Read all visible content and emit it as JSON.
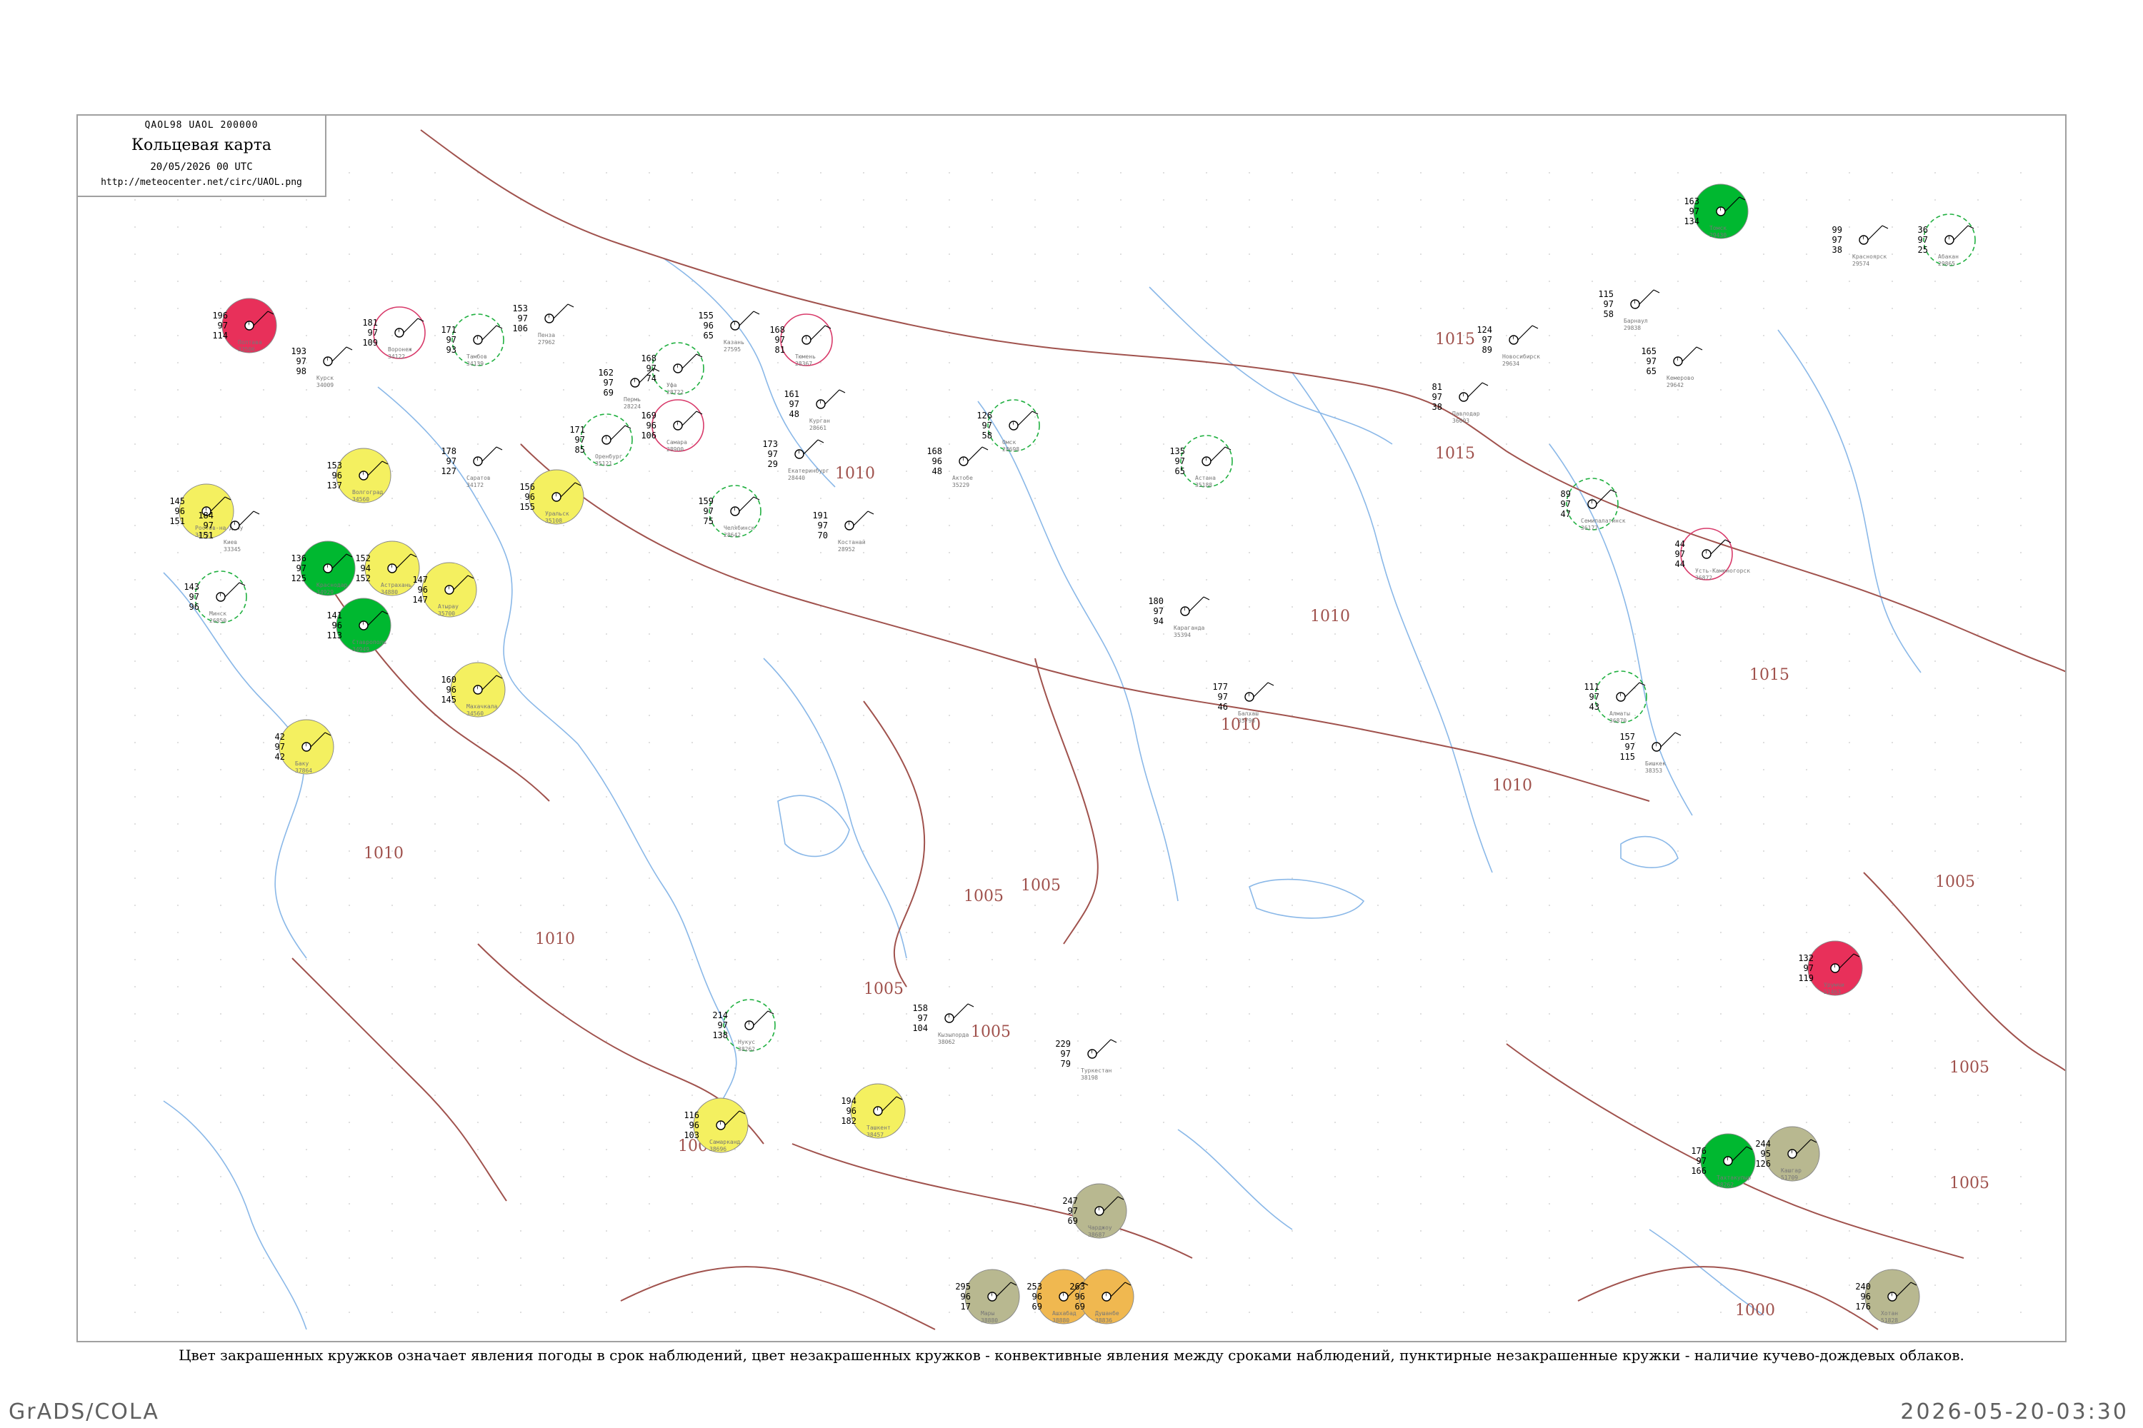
{
  "header": {
    "code": "QAOL98  UAOL  200000",
    "title": "Кольцевая карта",
    "datetime": "20/05/2026 00 UTC",
    "url": "http://meteocenter.net/circ/UAOL.png"
  },
  "caption": "Цвет закрашенных кружков означает явления погоды в срок наблюдений, цвет незакрашенных кружков - конвективные явления между сроками наблюдений, пунктирные незакрашенные кружки - наличие кучево-дождевых облаков.",
  "footer": {
    "left": "GrADS/COLA",
    "right": "2026-05-20-03:30"
  },
  "colors": {
    "isobar": "#a0524d",
    "river": "#8ab8e8",
    "green_fill": "#00b830",
    "yellow_fill": "#f4f060",
    "red_fill": "#e8305a",
    "olive_fill": "#b8b890",
    "orange_fill": "#f0b850",
    "green_ring": "#20b040",
    "pink_ring": "#d83a6a"
  },
  "isobar_labels": [
    "1015",
    "1015",
    "1015",
    "1010",
    "1010",
    "1010",
    "1010",
    "1010",
    "1010",
    "1005",
    "1005",
    "1005",
    "1005",
    "1005",
    "1005",
    "1005",
    "1005",
    "1000"
  ],
  "stations": [
    {
      "name": "Полтава",
      "id": "33506",
      "t": "196",
      "p": "97",
      "v": "114",
      "fill": "red"
    },
    {
      "name": "Курск",
      "id": "34009",
      "t": "193",
      "p": "97",
      "v": "98"
    },
    {
      "name": "Воронеж",
      "id": "34122",
      "t": "181",
      "p": "97",
      "v": "109"
    },
    {
      "name": "Тамбов",
      "id": "34139",
      "t": "171",
      "p": "97",
      "v": "93"
    },
    {
      "name": "Пенза",
      "id": "27962",
      "t": "153",
      "p": "97",
      "v": "106"
    },
    {
      "name": "Саратов",
      "id": "34172",
      "t": "178",
      "p": "97",
      "v": "127"
    },
    {
      "name": "Волгоград",
      "id": "34560",
      "t": "153",
      "p": "96",
      "v": "137",
      "fill": "yellow"
    },
    {
      "name": "Астрахань",
      "id": "34880",
      "t": "152",
      "p": "94",
      "v": "152",
      "fill": "yellow"
    },
    {
      "name": "Ростов-на-Дону",
      "id": "34731",
      "t": "145",
      "p": "96",
      "v": "151",
      "fill": "yellow"
    },
    {
      "name": "Краснодар",
      "id": "34929",
      "t": "136",
      "p": "97",
      "v": "125",
      "fill": "green"
    },
    {
      "name": "Ставрополь",
      "id": "34949",
      "t": "141",
      "p": "96",
      "v": "113",
      "fill": "green"
    },
    {
      "name": "Махачкала",
      "id": "34560",
      "t": "160",
      "p": "96",
      "v": "145",
      "fill": "yellow"
    },
    {
      "name": "Баку",
      "id": "37864",
      "t": "42",
      "p": "97",
      "v": "42",
      "fill": "yellow"
    },
    {
      "name": "Уральск",
      "id": "35108",
      "t": "156",
      "p": "96",
      "v": "155",
      "fill": "yellow"
    },
    {
      "name": "Атырау",
      "id": "35700",
      "t": "147",
      "p": "96",
      "v": "147",
      "fill": "yellow"
    },
    {
      "name": "Оренбург",
      "id": "35121",
      "t": "171",
      "p": "97",
      "v": "85"
    },
    {
      "name": "Самара",
      "id": "28900",
      "t": "169",
      "p": "96",
      "v": "106"
    },
    {
      "name": "Казань",
      "id": "27595",
      "t": "155",
      "p": "96",
      "v": "65"
    },
    {
      "name": "Уфа",
      "id": "28722",
      "t": "168",
      "p": "97",
      "v": "74"
    },
    {
      "name": "Пермь",
      "id": "28224",
      "t": "162",
      "p": "97",
      "v": "69"
    },
    {
      "name": "Екатеринбург",
      "id": "28440",
      "t": "173",
      "p": "97",
      "v": "29"
    },
    {
      "name": "Челябинск",
      "id": "28642",
      "t": "159",
      "p": "97",
      "v": "75"
    },
    {
      "name": "Курган",
      "id": "28661",
      "t": "161",
      "p": "97",
      "v": "48"
    },
    {
      "name": "Тюмень",
      "id": "28367",
      "t": "168",
      "p": "97",
      "v": "81"
    },
    {
      "name": "Омск",
      "id": "28698",
      "t": "126",
      "p": "97",
      "v": "58"
    },
    {
      "name": "Актобе",
      "id": "35229",
      "t": "168",
      "p": "96",
      "v": "48"
    },
    {
      "name": "Костанай",
      "id": "28952",
      "t": "191",
      "p": "97",
      "v": "70"
    },
    {
      "name": "Астана",
      "id": "35188",
      "t": "135",
      "p": "97",
      "v": "65"
    },
    {
      "name": "Караганда",
      "id": "35394",
      "t": "180",
      "p": "97",
      "v": "94"
    },
    {
      "name": "Павлодар",
      "id": "36003",
      "t": "81",
      "p": "97",
      "v": "38"
    },
    {
      "name": "Семипалатинск",
      "id": "36177",
      "t": "89",
      "p": "97",
      "v": "47"
    },
    {
      "name": "Новосибирск",
      "id": "29634",
      "t": "124",
      "p": "97",
      "v": "89"
    },
    {
      "name": "Барнаул",
      "id": "29838",
      "t": "115",
      "p": "97",
      "v": "58"
    },
    {
      "name": "Томск",
      "id": "29430",
      "t": "163",
      "p": "97",
      "v": "134",
      "fill": "green"
    },
    {
      "name": "Кемерово",
      "id": "29642",
      "t": "165",
      "p": "97",
      "v": "65"
    },
    {
      "name": "Красноярск",
      "id": "29574",
      "t": "99",
      "p": "97",
      "v": "38"
    },
    {
      "name": "Абакан",
      "id": "29865",
      "t": "36",
      "p": "97",
      "v": "25"
    },
    {
      "name": "Усть-Каменогорск",
      "id": "36872",
      "t": "44",
      "p": "97",
      "v": "44"
    },
    {
      "name": "Балхаш",
      "id": "35796",
      "t": "177",
      "p": "97",
      "v": "46"
    },
    {
      "name": "Алматы",
      "id": "36870",
      "t": "111",
      "p": "97",
      "v": "43"
    },
    {
      "name": "Бишкек",
      "id": "38353",
      "t": "157",
      "p": "97",
      "v": "115"
    },
    {
      "name": "Ташкент",
      "id": "38457",
      "t": "194",
      "p": "96",
      "v": "182",
      "fill": "yellow"
    },
    {
      "name": "Самарканд",
      "id": "38696",
      "t": "116",
      "p": "96",
      "v": "103",
      "fill": "yellow"
    },
    {
      "name": "Ашхабад",
      "id": "38880",
      "t": "253",
      "p": "96",
      "v": "69",
      "fill": "orange"
    },
    {
      "name": "Душанбе",
      "id": "38836",
      "t": "263",
      "p": "96",
      "v": "69",
      "fill": "orange"
    },
    {
      "name": "Нукус",
      "id": "38262",
      "t": "214",
      "p": "97",
      "v": "138"
    },
    {
      "name": "Кашгар",
      "id": "51709",
      "t": "244",
      "p": "95",
      "v": "126",
      "fill": "olive"
    },
    {
      "name": "Урумчи",
      "id": "51463",
      "t": "132",
      "p": "97",
      "v": "119",
      "fill": "red"
    },
    {
      "name": "Тахтакупыр",
      "id": "38262",
      "t": "176",
      "p": "97",
      "v": "166",
      "fill": "green"
    },
    {
      "name": "Кызылорда",
      "id": "38062",
      "t": "158",
      "p": "97",
      "v": "104"
    },
    {
      "name": "Туркестан",
      "id": "38198",
      "t": "229",
      "p": "97",
      "v": "79"
    },
    {
      "name": "Чарджоу",
      "id": "38687",
      "t": "247",
      "p": "97",
      "v": "69",
      "fill": "olive"
    },
    {
      "name": "Мары",
      "id": "38880",
      "t": "295",
      "p": "96",
      "v": "17",
      "fill": "olive"
    },
    {
      "name": "Хотан",
      "id": "51828",
      "t": "240",
      "p": "96",
      "v": "176",
      "fill": "olive"
    },
    {
      "name": "Минск",
      "id": "26850",
      "t": "143",
      "p": "97",
      "v": "96"
    },
    {
      "name": "Киев",
      "id": "33345",
      "t": "184",
      "p": "97",
      "v": "151"
    }
  ]
}
